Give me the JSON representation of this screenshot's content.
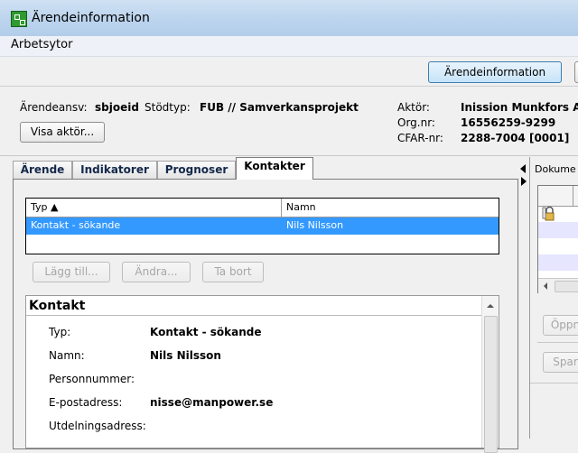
{
  "window": {
    "title": "Ärendeinformation"
  },
  "menu": {
    "items": [
      "Arbetsytor"
    ]
  },
  "toolbar": {
    "arendeinfo_button": "Ärendeinformation"
  },
  "header": {
    "arendeansv_label": "Ärendeansv:",
    "arendeansv_value": "sbjoeid",
    "stodtyp_label": "Stödtyp:",
    "stodtyp_value": "FUB // Samverkansprojekt",
    "visa_aktor_button": "Visa aktör...",
    "aktor_label": "Aktör:",
    "aktor_value": "Inission Munkfors A",
    "orgnr_label": "Org.nr:",
    "orgnr_value": "16556259-9299",
    "cfarnr_label": "CFAR-nr:",
    "cfarnr_value": "2288-7004 [0001]"
  },
  "tabs": [
    {
      "label": "Ärende"
    },
    {
      "label": "Indikatorer"
    },
    {
      "label": "Prognoser"
    },
    {
      "label": "Kontakter"
    }
  ],
  "contacts_table": {
    "columns": [
      "Typ ▲",
      "Namn"
    ],
    "rows": [
      {
        "typ": "Kontakt - sökande",
        "namn": "Nils Nilsson"
      }
    ]
  },
  "list_buttons": {
    "add": "Lägg till...",
    "edit": "Ändra...",
    "delete": "Ta bort"
  },
  "kontakt": {
    "title": "Kontakt",
    "fields": [
      {
        "label": "Typ:",
        "value": "Kontakt - sökande"
      },
      {
        "label": "Namn:",
        "value": "Nils Nilsson"
      },
      {
        "label": "Personnummer:",
        "value": ""
      },
      {
        "label": "E-postadress:",
        "value": "nisse@manpower.se"
      },
      {
        "label": "Utdelningsadress:",
        "value": ""
      }
    ]
  },
  "right_panel": {
    "title": "Dokume",
    "open_button": "Öppn",
    "save_button": "Spar"
  }
}
